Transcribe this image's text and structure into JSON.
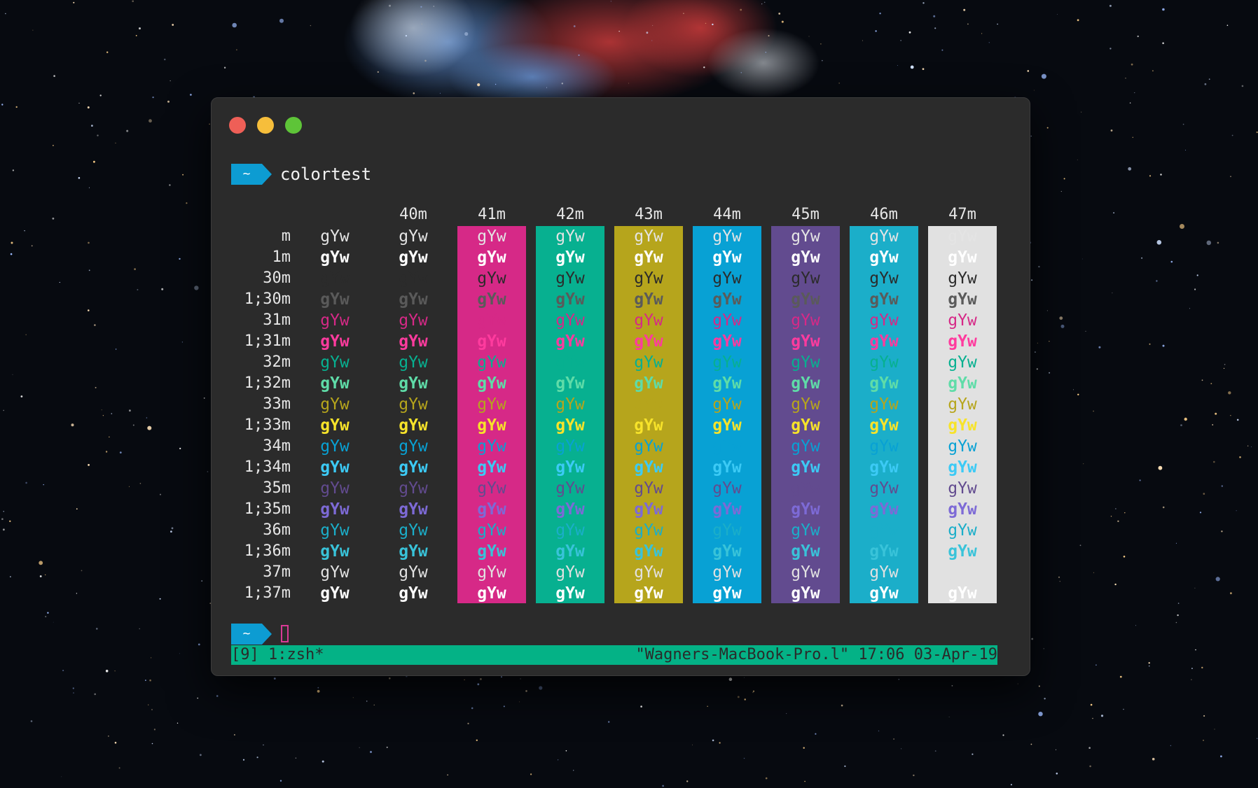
{
  "prompt": {
    "tilde": "~",
    "command": "colortest"
  },
  "colortest": {
    "sample": "gYw",
    "columns": [
      {
        "code": "",
        "bg": ""
      },
      {
        "code": "40m",
        "bg": ""
      },
      {
        "code": "41m",
        "bg": "#d62987"
      },
      {
        "code": "42m",
        "bg": "#07b090"
      },
      {
        "code": "43m",
        "bg": "#b6a51c"
      },
      {
        "code": "44m",
        "bg": "#08a1d4"
      },
      {
        "code": "45m",
        "bg": "#624b8f"
      },
      {
        "code": "46m",
        "bg": "#1baec9"
      },
      {
        "code": "47m",
        "bg": "#e1e1e1"
      }
    ],
    "rows": [
      {
        "label": "m",
        "fg": "#e4e4e4",
        "bold": false
      },
      {
        "label": "1m",
        "fg": "#ffffff",
        "bold": true
      },
      {
        "label": "30m",
        "fg": "#2b2b2b",
        "bold": false
      },
      {
        "label": "1;30m",
        "fg": "#5a5a5a",
        "bold": true
      },
      {
        "label": "31m",
        "fg": "#d62987",
        "bold": false
      },
      {
        "label": "1;31m",
        "fg": "#ff3b9e",
        "bold": true
      },
      {
        "label": "32m",
        "fg": "#07b090",
        "bold": false
      },
      {
        "label": "1;32m",
        "fg": "#5fdca8",
        "bold": true
      },
      {
        "label": "33m",
        "fg": "#b6a51c",
        "bold": false
      },
      {
        "label": "1;33m",
        "fg": "#f7e32a",
        "bold": true
      },
      {
        "label": "34m",
        "fg": "#08a1d4",
        "bold": false
      },
      {
        "label": "1;34m",
        "fg": "#3ccaf5",
        "bold": true
      },
      {
        "label": "35m",
        "fg": "#624b8f",
        "bold": false
      },
      {
        "label": "1;35m",
        "fg": "#7d6ad6",
        "bold": true
      },
      {
        "label": "36m",
        "fg": "#1baec9",
        "bold": false
      },
      {
        "label": "1;36m",
        "fg": "#39c3d9",
        "bold": true
      },
      {
        "label": "37m",
        "fg": "#e1e1e1",
        "bold": false
      },
      {
        "label": "1;37m",
        "fg": "#ffffff",
        "bold": true
      }
    ]
  },
  "statusbar": {
    "left": "[9] 1:zsh*",
    "right": "\"Wagners-MacBook-Pro.l\" 17:06 03-Apr-19"
  },
  "colors": {
    "prompt_bg": "#0d9cd2",
    "status_bg": "#04b286",
    "window_bg": "#2b2b2b"
  }
}
